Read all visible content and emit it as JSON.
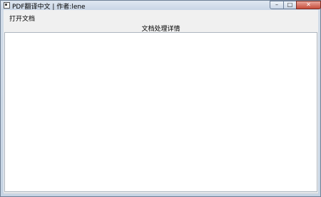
{
  "window": {
    "title": "PDF翻译中文 | 作者:lene",
    "controls": {
      "minimize": "–",
      "maximize": "□",
      "close": "✕"
    }
  },
  "menu": {
    "items": [
      {
        "label": "打开文档"
      }
    ]
  },
  "main": {
    "section_title": "文档处理详情"
  },
  "colors": {
    "titlebar": "#dfe7f1",
    "panel_bg": "#ffffff",
    "client_bg": "#f0f0f0"
  }
}
